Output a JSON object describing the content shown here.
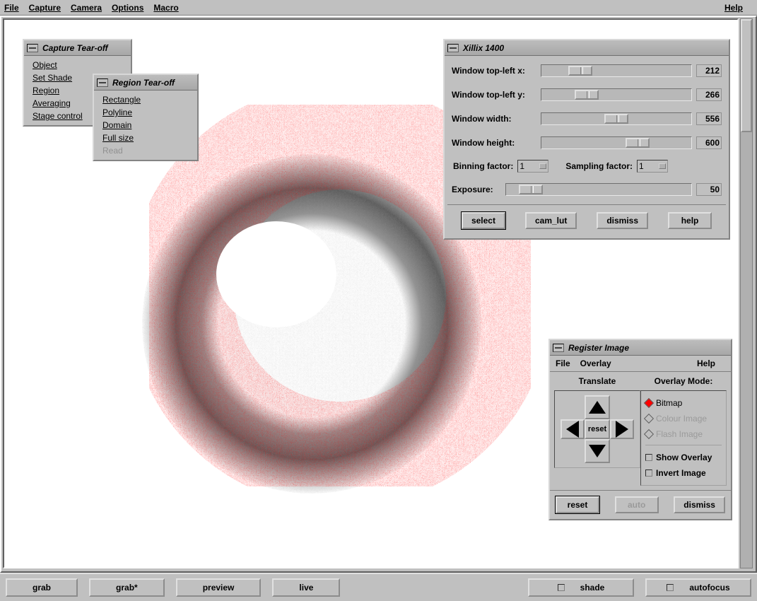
{
  "menubar": {
    "items": [
      "File",
      "Capture",
      "Camera",
      "Options",
      "Macro"
    ],
    "right": "Help"
  },
  "capture_tearoff": {
    "title": "Capture Tear-off",
    "items": [
      "Object",
      "Set Shade",
      "Region",
      "Averaging",
      "Stage control"
    ]
  },
  "region_tearoff": {
    "title": "Region Tear-off",
    "items": [
      "Rectangle",
      "Polyline",
      "Domain",
      "Full size"
    ],
    "disabled": "Read"
  },
  "xillix": {
    "title": "Xillix 1400",
    "rows": [
      {
        "label": "Window top-left x:",
        "value": "212",
        "thumb_pct": 18
      },
      {
        "label": "Window top-left y:",
        "value": "266",
        "thumb_pct": 22
      },
      {
        "label": "Window width:",
        "value": "556",
        "thumb_pct": 42
      },
      {
        "label": "Window height:",
        "value": "600",
        "thumb_pct": 56
      }
    ],
    "binning_label": "Binning factor:",
    "binning_value": "1",
    "sampling_label": "Sampling factor:",
    "sampling_value": "1",
    "exposure_label": "Exposure:",
    "exposure_value": "50",
    "exposure_thumb_pct": 7,
    "buttons": [
      "select",
      "cam_lut",
      "dismiss",
      "help"
    ]
  },
  "register": {
    "title": "Register Image",
    "menus": [
      "File",
      "Overlay"
    ],
    "menus_right": "Help",
    "translate_heading": "Translate",
    "reset_label": "reset",
    "overlay_heading": "Overlay Mode:",
    "radios": [
      {
        "label": "Bitmap",
        "selected": true,
        "enabled": true
      },
      {
        "label": "Colour Image",
        "selected": false,
        "enabled": false
      },
      {
        "label": "Flash Image",
        "selected": false,
        "enabled": false
      }
    ],
    "checks": [
      {
        "label": "Show Overlay"
      },
      {
        "label": "Invert Image"
      }
    ],
    "buttons": [
      {
        "label": "reset",
        "primary": true,
        "enabled": true
      },
      {
        "label": "auto",
        "primary": false,
        "enabled": false
      },
      {
        "label": "dismiss",
        "primary": false,
        "enabled": true
      }
    ]
  },
  "bottom": {
    "buttons": [
      "grab",
      "grab*",
      "preview",
      "live"
    ],
    "toggles": [
      "shade",
      "autofocus"
    ]
  }
}
